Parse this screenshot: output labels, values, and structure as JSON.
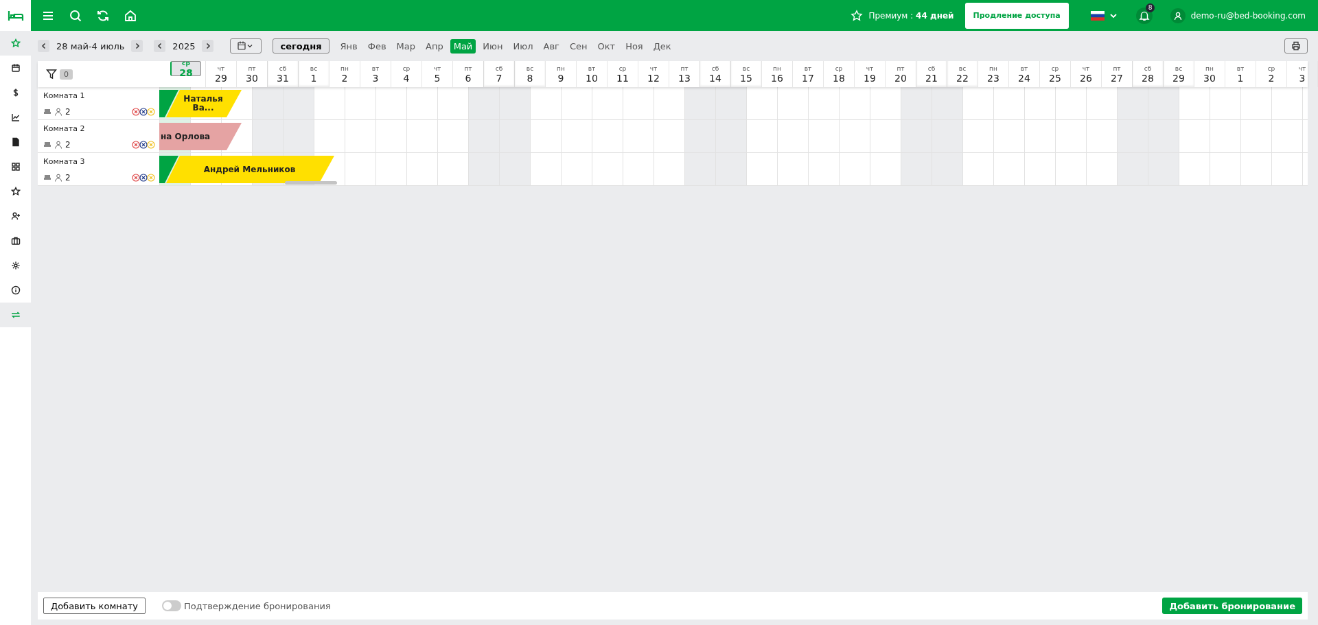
{
  "topbar": {
    "premium": "Премиум : **44 дней**",
    "renew_button": "Продление доступа",
    "notifications": "8",
    "user": "demo-ru@bed-booking.com"
  },
  "sidebar": {
    "items": [
      {
        "selected": true
      },
      {
        "selected": false
      },
      {
        "selected": false
      },
      {
        "selected": false
      },
      {
        "selected": false
      },
      {
        "selected": false
      },
      {
        "selected": false
      },
      {
        "selected": false
      },
      {
        "selected": false
      },
      {
        "selected": false
      },
      {
        "selected": false
      },
      {
        "selected": true
      }
    ]
  },
  "toolbar": {
    "range": "28 май-4 июль",
    "year": "2025",
    "today_button": "сегодня",
    "months": [
      {
        "label": "Янв",
        "selected": false
      },
      {
        "label": "Фев",
        "selected": false
      },
      {
        "label": "Мар",
        "selected": false
      },
      {
        "label": "Апр",
        "selected": false
      },
      {
        "label": "Май",
        "selected": true
      },
      {
        "label": "Июн",
        "selected": false
      },
      {
        "label": "Июл",
        "selected": false
      },
      {
        "label": "Авг",
        "selected": false
      },
      {
        "label": "Сен",
        "selected": false
      },
      {
        "label": "Окт",
        "selected": false
      },
      {
        "label": "Ноя",
        "selected": false
      },
      {
        "label": "Дек",
        "selected": false
      }
    ]
  },
  "filter": {
    "count": "0"
  },
  "days": [
    {
      "dow": "ср",
      "num": "28",
      "weekend": false,
      "today": true
    },
    {
      "dow": "чт",
      "num": "29",
      "weekend": false,
      "today": false
    },
    {
      "dow": "пт",
      "num": "30",
      "weekend": false,
      "today": false
    },
    {
      "dow": "сб",
      "num": "31",
      "weekend": true,
      "today": false
    },
    {
      "dow": "вс",
      "num": "1",
      "weekend": true,
      "today": false
    },
    {
      "dow": "пн",
      "num": "2",
      "weekend": false,
      "today": false
    },
    {
      "dow": "вт",
      "num": "3",
      "weekend": false,
      "today": false
    },
    {
      "dow": "ср",
      "num": "4",
      "weekend": false,
      "today": false
    },
    {
      "dow": "чт",
      "num": "5",
      "weekend": false,
      "today": false
    },
    {
      "dow": "пт",
      "num": "6",
      "weekend": false,
      "today": false
    },
    {
      "dow": "сб",
      "num": "7",
      "weekend": true,
      "today": false
    },
    {
      "dow": "вс",
      "num": "8",
      "weekend": true,
      "today": false
    },
    {
      "dow": "пн",
      "num": "9",
      "weekend": false,
      "today": false
    },
    {
      "dow": "вт",
      "num": "10",
      "weekend": false,
      "today": false
    },
    {
      "dow": "ср",
      "num": "11",
      "weekend": false,
      "today": false
    },
    {
      "dow": "чт",
      "num": "12",
      "weekend": false,
      "today": false
    },
    {
      "dow": "пт",
      "num": "13",
      "weekend": false,
      "today": false
    },
    {
      "dow": "сб",
      "num": "14",
      "weekend": true,
      "today": false
    },
    {
      "dow": "вс",
      "num": "15",
      "weekend": true,
      "today": false
    },
    {
      "dow": "пн",
      "num": "16",
      "weekend": false,
      "today": false
    },
    {
      "dow": "вт",
      "num": "17",
      "weekend": false,
      "today": false
    },
    {
      "dow": "ср",
      "num": "18",
      "weekend": false,
      "today": false
    },
    {
      "dow": "чт",
      "num": "19",
      "weekend": false,
      "today": false
    },
    {
      "dow": "пт",
      "num": "20",
      "weekend": false,
      "today": false
    },
    {
      "dow": "сб",
      "num": "21",
      "weekend": true,
      "today": false
    },
    {
      "dow": "вс",
      "num": "22",
      "weekend": true,
      "today": false
    },
    {
      "dow": "пн",
      "num": "23",
      "weekend": false,
      "today": false
    },
    {
      "dow": "вт",
      "num": "24",
      "weekend": false,
      "today": false
    },
    {
      "dow": "ср",
      "num": "25",
      "weekend": false,
      "today": false
    },
    {
      "dow": "чт",
      "num": "26",
      "weekend": false,
      "today": false
    },
    {
      "dow": "пт",
      "num": "27",
      "weekend": false,
      "today": false
    },
    {
      "dow": "сб",
      "num": "28",
      "weekend": true,
      "today": false
    },
    {
      "dow": "вс",
      "num": "29",
      "weekend": true,
      "today": false
    },
    {
      "dow": "пн",
      "num": "30",
      "weekend": false,
      "today": false
    },
    {
      "dow": "вт",
      "num": "1",
      "weekend": false,
      "today": false
    },
    {
      "dow": "ср",
      "num": "2",
      "weekend": false,
      "today": false
    },
    {
      "dow": "чт",
      "num": "3",
      "weekend": false,
      "today": false
    }
  ],
  "rooms": [
    {
      "name": "Комната 1",
      "guests": "2",
      "bookings": [
        {
          "guest": "Наталья Ва...",
          "color": "#ffe000",
          "checked_in": true
        }
      ]
    },
    {
      "name": "Комната 2",
      "guests": "2",
      "bookings": [
        {
          "guest": "на Орлова",
          "color": "#e5a3a3",
          "checked_in": false
        }
      ]
    },
    {
      "name": "Комната 3",
      "guests": "2",
      "bookings": [
        {
          "guest": "Андрей Мельников",
          "color": "#ffe000",
          "checked_in": true
        }
      ]
    }
  ],
  "footer": {
    "add_room": "Добавить комнату",
    "confirmation": {
      "label": "Подтверждение бронирования",
      "on": false
    },
    "add_booking": "Добавить бронирование"
  }
}
